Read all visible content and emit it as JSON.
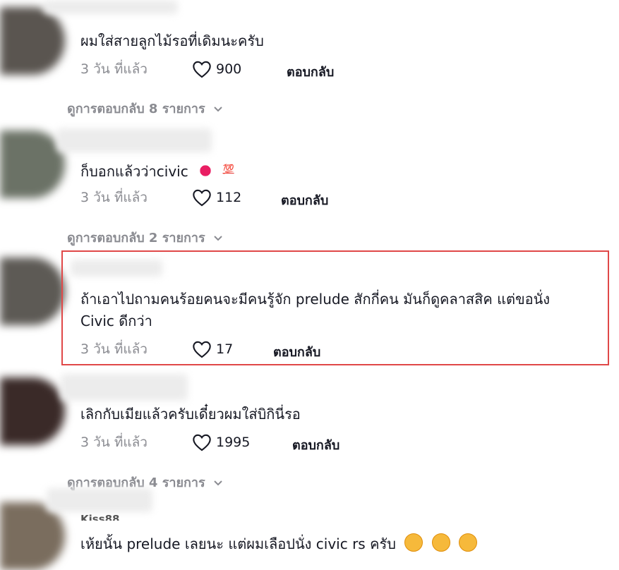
{
  "comments": [
    {
      "text": "ผมใส่สายลูกไม้รอที่เดิมนะครับ",
      "time": "3 วัน ที่แล้ว",
      "likes": "900",
      "reply": "ตอบกลับ",
      "view_replies": "ดูการตอบกลับ 8 รายการ"
    },
    {
      "text": "ก็บอกแล้วว่าcivic",
      "emoji_100": "💯",
      "time": "3 วัน ที่แล้ว",
      "likes": "112",
      "reply": "ตอบกลับ",
      "view_replies": "ดูการตอบกลับ 2 รายการ"
    },
    {
      "text_line1": "ถ้าเอาไปถามคนร้อยคนจะมีคนรู้จัก prelude สักกี่คน มันก็ดูคลาสสิค แต่ขอนั่ง",
      "text_line2": "Civic ดีกว่า",
      "time": "3 วัน ที่แล้ว",
      "likes": "17",
      "reply": "ตอบกลับ"
    },
    {
      "text": "เลิกกับเมียแล้วครับเดี๋ยวผมใส่บิกินี่รอ",
      "time": "3 วัน ที่แล้ว",
      "likes": "1995",
      "reply": "ตอบกลับ",
      "view_replies": "ดูการตอบกลับ 4 รายการ"
    },
    {
      "username": "Kiss88",
      "text": "เห้ยนั้น prelude เลยนะ แต่ผมเลือปนั่ง civic rs ครับ"
    }
  ],
  "colors": {
    "highlight_border": "#e04848",
    "muted_text": "#8a8b91",
    "primary_text": "#161823"
  },
  "icons": {
    "like": "heart-outline-icon",
    "expand": "chevron-down-icon",
    "kiss": "kiss-lips-emoji",
    "hundred": "hundred-points-emoji",
    "sweat_smile": "sweat-smile-emoji"
  }
}
